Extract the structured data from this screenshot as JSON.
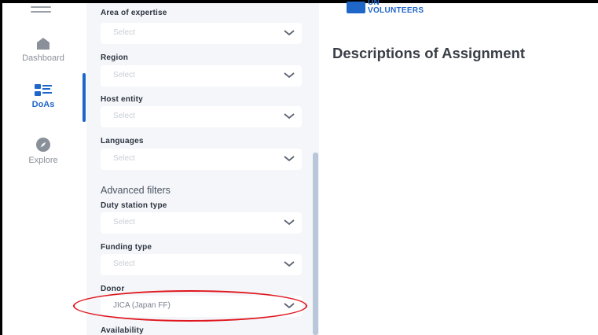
{
  "nav": {
    "items": [
      {
        "label": "Dashboard",
        "icon": "home-icon"
      },
      {
        "label": "DoAs",
        "icon": "list-icon"
      },
      {
        "label": "Explore",
        "icon": "compass-icon"
      }
    ],
    "active": "DoAs"
  },
  "brand": {
    "line1": "UN",
    "line2": "VOLUNTEERS",
    "color": "#1f66c9"
  },
  "page": {
    "title": "Descriptions of Assignment"
  },
  "filters": {
    "area_of_expertise": {
      "label": "Area of expertise",
      "placeholder": "Select"
    },
    "region": {
      "label": "Region",
      "placeholder": "Select"
    },
    "host_entity": {
      "label": "Host entity",
      "placeholder": "Select"
    },
    "languages": {
      "label": "Languages",
      "placeholder": "Select"
    },
    "advanced_heading": "Advanced filters",
    "duty_station_type": {
      "label": "Duty station type",
      "placeholder": "Select"
    },
    "funding_type": {
      "label": "Funding type",
      "placeholder": "Select"
    },
    "donor": {
      "label": "Donor",
      "value": "JICA (Japan FF)"
    },
    "availability": {
      "label": "Availability"
    }
  },
  "annotation": {
    "color": "#e0161d"
  }
}
